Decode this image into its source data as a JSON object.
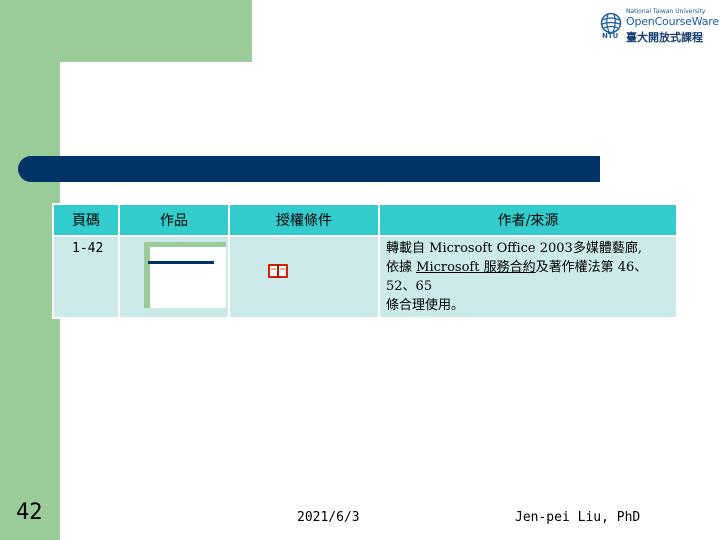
{
  "logo": {
    "line1": "National Taiwan University",
    "line2": "OpenCourseWare",
    "line3": "臺大開放式課程",
    "ntu": "NTU"
  },
  "table": {
    "headers": [
      "頁碼",
      "作品",
      "授權條件",
      "作者/來源"
    ],
    "row": {
      "pages": "1-42",
      "source_line1": "轉載自 Microsoft Office 2003多媒體藝廊,",
      "source_prefix": "依據 ",
      "source_link": "Microsoft 服務合約",
      "source_suffix": "及著作權法第 46、52、65",
      "source_line3": "條合理使用。"
    }
  },
  "footer": {
    "slide_number": "42",
    "date": "2021/6/3",
    "author": "Jen-pei Liu, PhD"
  },
  "colors": {
    "green": "#99cc99",
    "navy": "#003466",
    "header_teal": "#33cccc",
    "cell_teal": "#cceaea"
  },
  "icons": {
    "work": "slide-template-thumbnail",
    "license": "open-book-icon"
  }
}
